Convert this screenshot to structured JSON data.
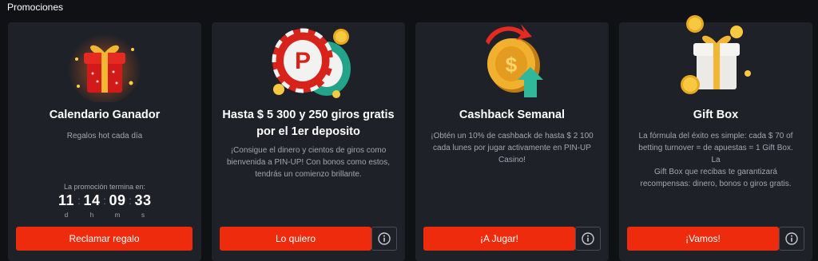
{
  "section_title": "Promociones",
  "colors": {
    "button": "#ef2b0d",
    "card": "#1f2128",
    "background": "#0f1115"
  },
  "cards": [
    {
      "title": "Calendario Ganador",
      "description": "Regalos hot cada día",
      "image_icon": "red-gift-box-icon",
      "timer": {
        "label": "La promoción termina en:",
        "units": [
          {
            "value": "11",
            "label": "d"
          },
          {
            "value": "14",
            "label": "h"
          },
          {
            "value": "09",
            "label": "m"
          },
          {
            "value": "33",
            "label": "s"
          }
        ]
      },
      "button": "Reclamar regalo"
    },
    {
      "title_lines": [
        "Hasta $ 5 300 y 250 giros gratis",
        "por el 1er deposito"
      ],
      "description_lines": [
        "¡Consigue el dinero y cientos de giros como",
        "bienvenida a PIN-UP! Con bonos como estos,",
        "tendrás un comienzo brillante."
      ],
      "image_icon": "casino-chips-icon",
      "button": "Lo quiero"
    },
    {
      "title": "Cashback Semanal",
      "description_lines": [
        "¡Obtén un 10% de cashback de hasta $ 2 100",
        "cada lunes por jugar activamente en PIN-UP",
        "Casino!"
      ],
      "image_icon": "cashback-coin-icon",
      "button": "¡A Jugar!"
    },
    {
      "title": "Gift Box",
      "description_lines": [
        "La fórmula del éxito es simple: cada $ 70 of",
        "betting turnover = de apuestas = 1 Gift Box. La",
        "Gift Box que recibas te garantizará",
        "recompensas: dinero, bonos o giros gratis."
      ],
      "image_icon": "white-gift-box-icon",
      "button": "¡Vamos!"
    }
  ]
}
